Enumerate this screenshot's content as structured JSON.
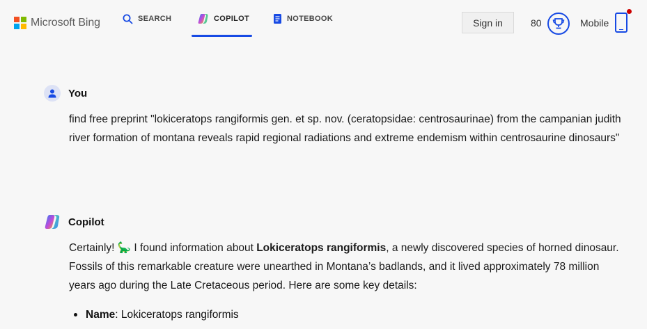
{
  "brand": {
    "name": "Microsoft Bing",
    "logo_colors": [
      "#f25022",
      "#7fba00",
      "#00a4ef",
      "#ffb900"
    ],
    "accent": "#174ae4"
  },
  "nav": {
    "search": "SEARCH",
    "copilot": "COPILOT",
    "notebook": "NOTEBOOK",
    "active": "COPILOT"
  },
  "header": {
    "signin": "Sign in",
    "points": "80",
    "mobile": "Mobile"
  },
  "conversation": {
    "user": {
      "author": "You",
      "text": "find free preprint \"lokiceratops rangiformis gen. et sp. nov. (ceratopsidae: centrosaurinae) from the campanian judith river formation of montana reveals rapid regional radiations and extreme endemism within centrosaurine dinosaurs\""
    },
    "copilot": {
      "author": "Copilot",
      "intro": "Certainly! ",
      "emoji": "🦕",
      "pre": " I found information about ",
      "bold": "Lokiceratops rangiformis",
      "post": ", a newly discovered species of horned dinosaur. Fossils of this remarkable creature were unearthed in Montana’s badlands, and it lived approximately 78 million years ago during the Late Cretaceous period. Here are some key details:",
      "bullets": [
        {
          "label": "Name",
          "value": ": Lokiceratops rangiformis"
        }
      ]
    }
  }
}
